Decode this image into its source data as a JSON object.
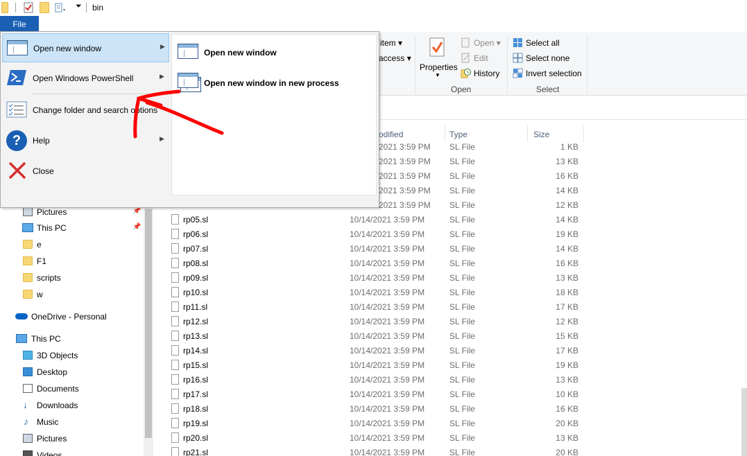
{
  "titlebar": {
    "title": "bin"
  },
  "file_tab": "File",
  "menu": {
    "items": [
      {
        "label": "Open new window",
        "has_submenu": true,
        "icon": "window-icon"
      },
      {
        "label": "Open Windows PowerShell",
        "has_submenu": true,
        "icon": "powershell-icon"
      },
      {
        "label": "Change folder and search options",
        "has_submenu": false,
        "icon": "options-icon"
      },
      {
        "label": "Help",
        "has_submenu": true,
        "icon": "help-icon"
      },
      {
        "label": "Close",
        "has_submenu": false,
        "icon": "close-icon"
      }
    ],
    "submenu": [
      {
        "label": "Open new window",
        "icon": "window-icon"
      },
      {
        "label": "Open new window in new process",
        "icon": "window-process-icon"
      }
    ]
  },
  "ribbon": {
    "item_partial": "item",
    "access_partial": "access",
    "properties": "Properties",
    "open": "Open",
    "edit": "Edit",
    "history": "History",
    "open_group": "Open",
    "select_all": "Select all",
    "select_none": "Select none",
    "invert_selection": "Invert selection",
    "select_group": "Select"
  },
  "columns": {
    "date": "odified",
    "type": "Type",
    "size": "Size"
  },
  "nav": {
    "quick": [
      {
        "label": "Pictures",
        "pinned": true
      },
      {
        "label": "This PC",
        "pinned": true
      },
      {
        "label": "e",
        "pinned": false
      },
      {
        "label": "F1",
        "pinned": false
      },
      {
        "label": "scripts",
        "pinned": false
      },
      {
        "label": "w",
        "pinned": false
      }
    ],
    "onedrive": "OneDrive - Personal",
    "thispc": "This PC",
    "pc_items": [
      "3D Objects",
      "Desktop",
      "Documents",
      "Downloads",
      "Music",
      "Pictures",
      "Videos"
    ]
  },
  "files_hidden": [
    {
      "date": "2021 3:59 PM",
      "type": "SL File",
      "size": "1 KB"
    },
    {
      "date": "2021 3:59 PM",
      "type": "SL File",
      "size": "13 KB"
    },
    {
      "date": "2021 3:59 PM",
      "type": "SL File",
      "size": "16 KB"
    },
    {
      "date": "2021 3:59 PM",
      "type": "SL File",
      "size": "14 KB"
    },
    {
      "date": "2021 3:59 PM",
      "type": "SL File",
      "size": "12 KB"
    }
  ],
  "files": [
    {
      "name": "rp05.sl",
      "date": "10/14/2021 3:59 PM",
      "type": "SL File",
      "size": "14 KB"
    },
    {
      "name": "rp06.sl",
      "date": "10/14/2021 3:59 PM",
      "type": "SL File",
      "size": "19 KB"
    },
    {
      "name": "rp07.sl",
      "date": "10/14/2021 3:59 PM",
      "type": "SL File",
      "size": "14 KB"
    },
    {
      "name": "rp08.sl",
      "date": "10/14/2021 3:59 PM",
      "type": "SL File",
      "size": "16 KB"
    },
    {
      "name": "rp09.sl",
      "date": "10/14/2021 3:59 PM",
      "type": "SL File",
      "size": "13 KB"
    },
    {
      "name": "rp10.sl",
      "date": "10/14/2021 3:59 PM",
      "type": "SL File",
      "size": "18 KB"
    },
    {
      "name": "rp11.sl",
      "date": "10/14/2021 3:59 PM",
      "type": "SL File",
      "size": "17 KB"
    },
    {
      "name": "rp12.sl",
      "date": "10/14/2021 3:59 PM",
      "type": "SL File",
      "size": "12 KB"
    },
    {
      "name": "rp13.sl",
      "date": "10/14/2021 3:59 PM",
      "type": "SL File",
      "size": "15 KB"
    },
    {
      "name": "rp14.sl",
      "date": "10/14/2021 3:59 PM",
      "type": "SL File",
      "size": "17 KB"
    },
    {
      "name": "rp15.sl",
      "date": "10/14/2021 3:59 PM",
      "type": "SL File",
      "size": "19 KB"
    },
    {
      "name": "rp16.sl",
      "date": "10/14/2021 3:59 PM",
      "type": "SL File",
      "size": "13 KB"
    },
    {
      "name": "rp17.sl",
      "date": "10/14/2021 3:59 PM",
      "type": "SL File",
      "size": "10 KB"
    },
    {
      "name": "rp18.sl",
      "date": "10/14/2021 3:59 PM",
      "type": "SL File",
      "size": "16 KB"
    },
    {
      "name": "rp19.sl",
      "date": "10/14/2021 3:59 PM",
      "type": "SL File",
      "size": "20 KB"
    },
    {
      "name": "rp20.sl",
      "date": "10/14/2021 3:59 PM",
      "type": "SL File",
      "size": "13 KB"
    },
    {
      "name": "rp21.sl",
      "date": "10/14/2021 3:59 PM",
      "type": "SL File",
      "size": "20 KB"
    }
  ],
  "colors": {
    "accent": "#1a5fb4",
    "hover": "#cce4f7",
    "annotation": "#ff0000"
  }
}
